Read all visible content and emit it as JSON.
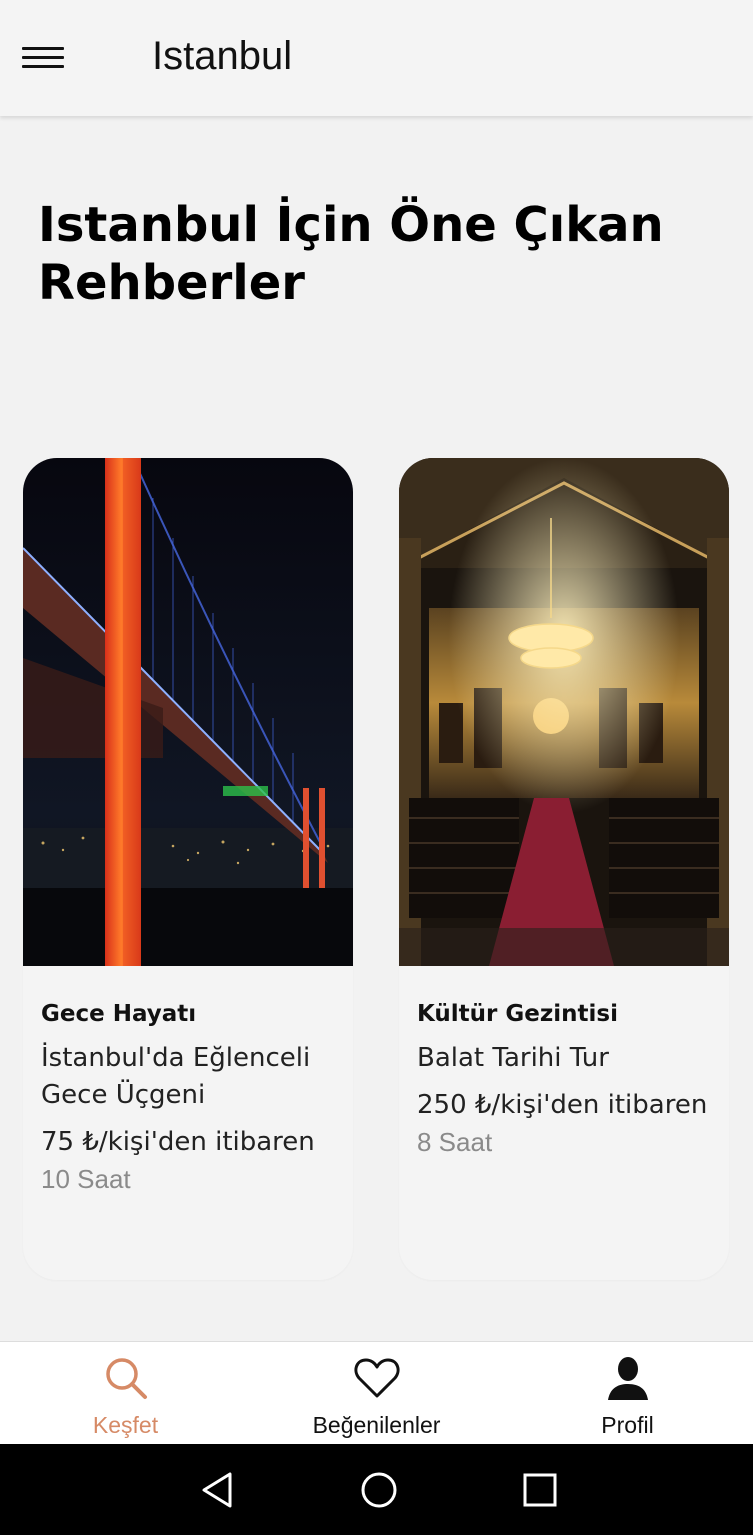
{
  "app_bar": {
    "title": "Istanbul",
    "menu_icon": "hamburger-menu-icon"
  },
  "heading": "Istanbul İçin Öne Çıkan Rehberler",
  "cards": [
    {
      "category": "Gece Hayatı",
      "name": "İstanbul'da Eğlenceli Gece Üçgeni",
      "price": "75 ₺/kişi'den itibaren",
      "duration": "10 Saat",
      "image": "bosphorus-bridge-night-photo"
    },
    {
      "category": "Kültür Gezintisi",
      "name": "Balat Tarihi Tur",
      "price": "250 ₺/kişi'den itibaren",
      "duration": "8 Saat",
      "image": "church-interior-iconostasis-photo"
    }
  ],
  "bottom_nav": {
    "items": [
      {
        "label": "Keşfet",
        "icon": "search-icon",
        "active": true
      },
      {
        "label": "Beğenilenler",
        "icon": "heart-icon",
        "active": false
      },
      {
        "label": "Profil",
        "icon": "person-icon",
        "active": false
      }
    ],
    "active_color": "#d68a66"
  },
  "system_nav": {
    "icons": [
      "back-triangle-icon",
      "home-circle-icon",
      "recents-square-icon"
    ]
  }
}
